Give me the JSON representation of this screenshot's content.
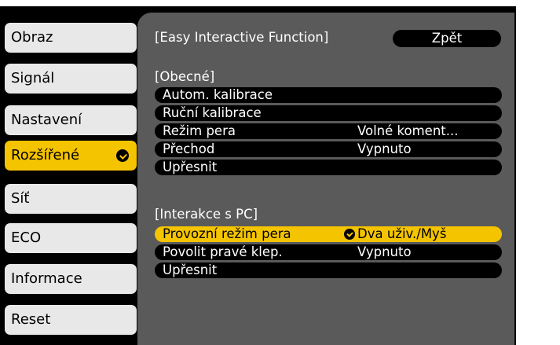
{
  "sidebar": {
    "items": [
      {
        "label": "Obraz"
      },
      {
        "label": "Signál"
      },
      {
        "label": "Nastavení"
      },
      {
        "label": "Rozšířené"
      },
      {
        "label": "Síť"
      },
      {
        "label": "ECO"
      },
      {
        "label": "Informace"
      },
      {
        "label": "Reset"
      }
    ],
    "active_index": 3
  },
  "header": {
    "title": "[Easy Interactive Function]",
    "back_label": "Zpět"
  },
  "sections": [
    {
      "title": "[Obecné]",
      "rows": [
        {
          "label": "Autom. kalibrace",
          "value": ""
        },
        {
          "label": "Ruční kalibrace",
          "value": ""
        },
        {
          "label": "Režim pera",
          "value": "Volné koment..."
        },
        {
          "label": "Přechod",
          "value": "Vypnuto"
        },
        {
          "label": "Upřesnit",
          "value": ""
        }
      ]
    },
    {
      "title": "[Interakce s PC]",
      "rows": [
        {
          "label": "Provozní režim pera",
          "value": "Dva uživ./Myš"
        },
        {
          "label": "Povolit pravé klep.",
          "value": "Vypnuto"
        },
        {
          "label": "Upřesnit",
          "value": ""
        }
      ]
    }
  ],
  "colors": {
    "accent": "#f5c400",
    "background": "#000000",
    "panel": "#5a5a5a",
    "menu_item": "#e8e8e8"
  }
}
